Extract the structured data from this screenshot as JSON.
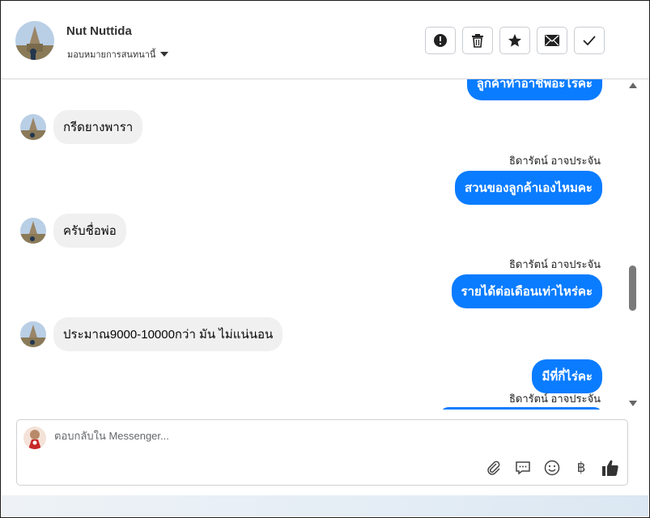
{
  "header": {
    "contact_name": "Nut Nuttida",
    "assign_label": "มอบหมายการสนทนานี้",
    "actions": [
      "alert-icon",
      "trash-icon",
      "star-icon",
      "envelope-icon",
      "check-icon"
    ]
  },
  "messages": {
    "top_partial": "ลูกค้าทำอาชีพอะไรคะ",
    "m1": "กรีดยางพารา",
    "sender1": "ธิดารัตน์ อาจประจัน",
    "m2": "สวนของลูกค้าเองไหมคะ",
    "m3": "ครับชื่อพ่อ",
    "sender2": "ธิดารัตน์ อาจประจัน",
    "m4": "รายได้ต่อเดือนเท่าไหร่คะ",
    "m5": "ประมาณ9000-10000กว่า มัน ไม่แน่นอน",
    "m6": "มีที่กี่ไร่คะ",
    "sender3": "ธิดารัตน์ อาจประจัน"
  },
  "composer": {
    "placeholder": "ตอบกลับใน Messenger...",
    "baht_symbol": "฿",
    "tools": [
      "paperclip-icon",
      "speech-bubble-icon",
      "emoji-icon",
      "baht-icon",
      "thumbs-up-icon"
    ]
  },
  "colors": {
    "outgoing_bubble": "#0a7cff",
    "incoming_bubble": "#f0f0f0"
  }
}
